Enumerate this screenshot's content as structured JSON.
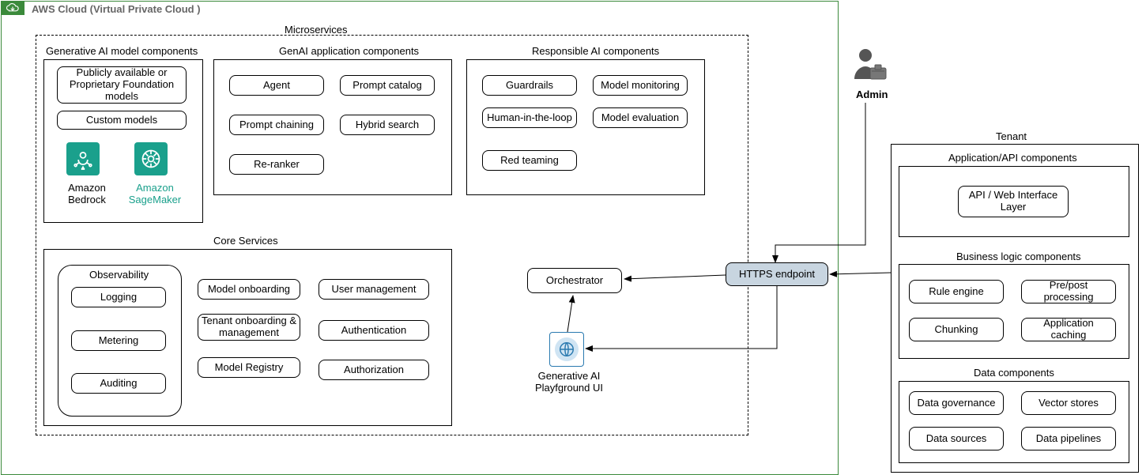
{
  "aws_cloud_title": "AWS Cloud (Virtual Private Cloud )",
  "microservices_title": "Microservices",
  "sections": {
    "genai_models": {
      "title": "Generative AI model components",
      "foundation": "Publicly available or Proprietary Foundation models",
      "custom": "Custom models",
      "bedrock": "Amazon Bedrock",
      "sagemaker": "Amazon SageMaker"
    },
    "genai_app": {
      "title": "GenAI application components",
      "agent": "Agent",
      "prompt_catalog": "Prompt catalog",
      "prompt_chaining": "Prompt chaining",
      "hybrid_search": "Hybrid search",
      "re_ranker": "Re-ranker"
    },
    "responsible": {
      "title": "Responsible AI components",
      "guardrails": "Guardrails",
      "model_monitoring": "Model monitoring",
      "human_loop": "Human-in-the-loop",
      "model_eval": "Model evaluation",
      "red_teaming": "Red teaming"
    },
    "core": {
      "title": "Core Services",
      "observability": {
        "title": "Observability",
        "logging": "Logging",
        "metering": "Metering",
        "auditing": "Auditing"
      },
      "model_onboarding": "Model onboarding",
      "tenant_onboarding": "Tenant onboarding & management",
      "model_registry": "Model Registry",
      "user_mgmt": "User management",
      "authn": "Authentication",
      "authz": "Authorization"
    }
  },
  "orchestrator": "Orchestrator",
  "playground_label": "Generative AI Playfground UI",
  "https_endpoint": "HTTPS endpoint",
  "admin_label": "Admin",
  "tenant": {
    "title": "Tenant",
    "api_section": "Application/API components",
    "api_layer": "API / Web Interface Layer",
    "biz_section": "Business logic components",
    "rule_engine": "Rule engine",
    "prepost": "Pre/post processing",
    "chunking": "Chunking",
    "app_cache": "Application caching",
    "data_section": "Data components",
    "data_gov": "Data governance",
    "vector": "Vector stores",
    "data_src": "Data sources",
    "data_pipe": "Data pipelines"
  }
}
